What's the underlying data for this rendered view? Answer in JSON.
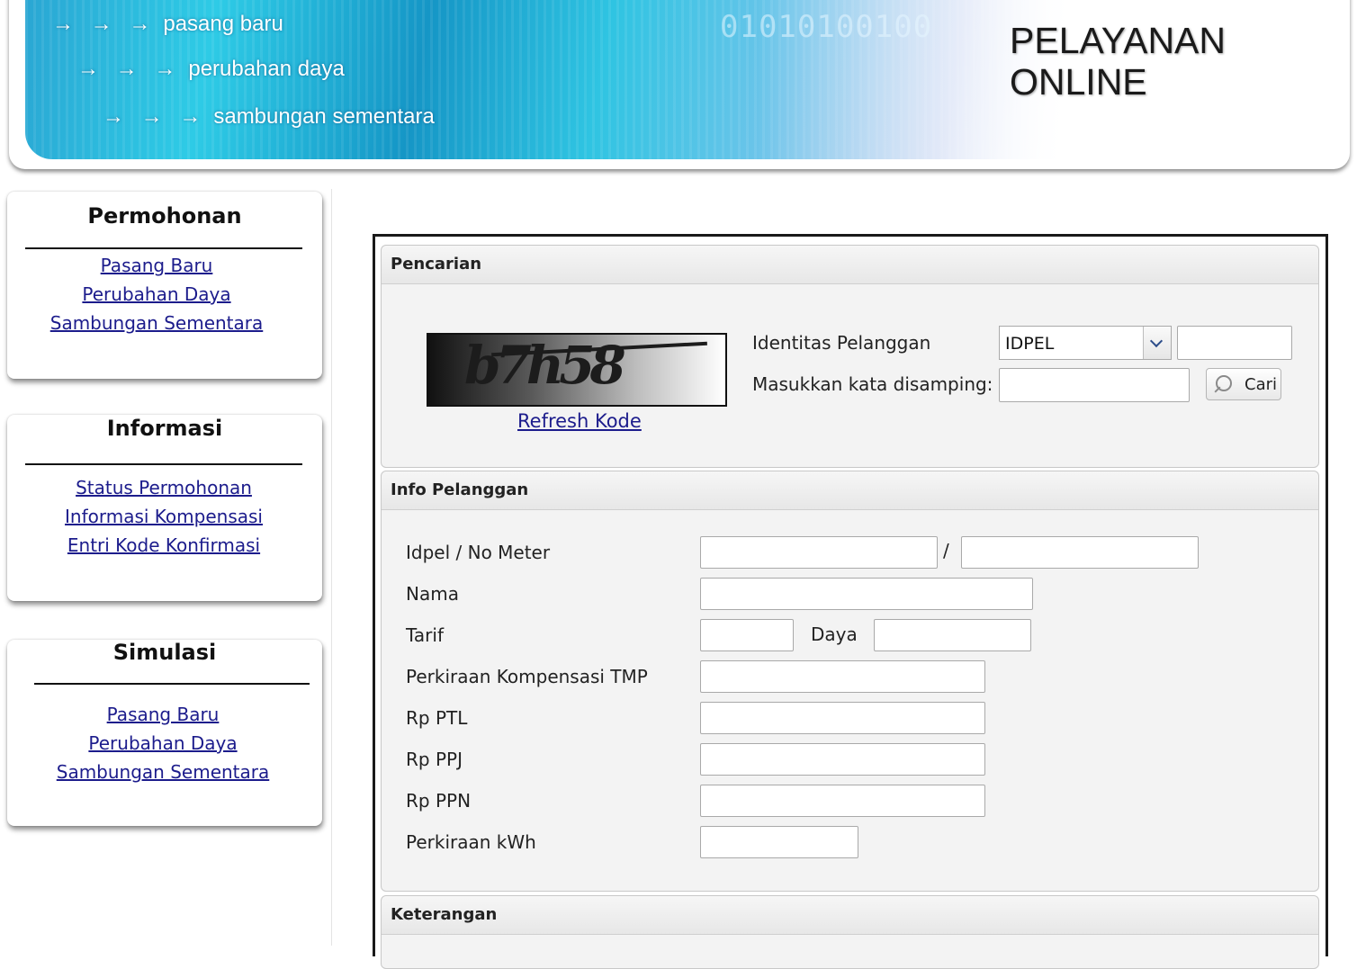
{
  "banner": {
    "links": [
      "pasang baru",
      "perubahan daya",
      "sambungan sementara"
    ],
    "arrows": "→ → →",
    "binary": "01010100100",
    "title_line1": "PELAYANAN",
    "title_line2": "ONLINE"
  },
  "sidebar": {
    "permohonan": {
      "title": "Permohonan",
      "links": [
        "Pasang Baru",
        "Perubahan Daya",
        "Sambungan Sementara"
      ]
    },
    "informasi": {
      "title": "Informasi",
      "links": [
        "Status Permohonan",
        "Informasi Kompensasi",
        "Entri Kode Konfirmasi"
      ]
    },
    "simulasi": {
      "title": "Simulasi",
      "links": [
        "Pasang Baru",
        "Perubahan Daya",
        "Sambungan Sementara"
      ]
    }
  },
  "pencarian": {
    "title": "Pencarian",
    "captcha_text": "b7h58",
    "refresh_label": "Refresh Kode",
    "identitas_label": "Identitas Pelanggan",
    "identitas_select": "IDPEL",
    "identitas_value": "",
    "kata_label": "Masukkan kata disamping:",
    "kata_value": "",
    "cari_label": "Cari"
  },
  "info_pelanggan": {
    "title": "Info Pelanggan",
    "idpel_label": "Idpel / No Meter",
    "slash": "/",
    "nama_label": "Nama",
    "tarif_label": "Tarif",
    "daya_label": "Daya",
    "kompensasi_label": "Perkiraan Kompensasi TMP",
    "ptl_label": "Rp PTL",
    "ppj_label": "Rp PPJ",
    "ppn_label": "Rp PPN",
    "kwh_label": "Perkiraan kWh"
  },
  "keterangan": {
    "title": "Keterangan"
  },
  "colors": {
    "link": "#1c1c8c",
    "banner_accent": "#2ecbe6"
  }
}
